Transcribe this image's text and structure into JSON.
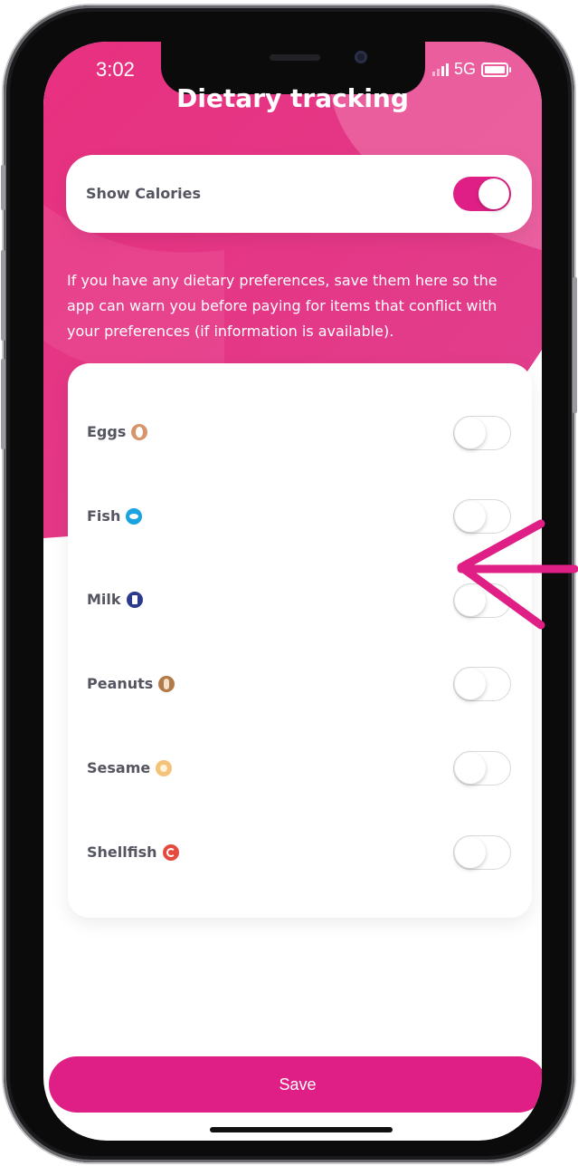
{
  "status_bar": {
    "time": "3:02",
    "network": "5G"
  },
  "page": {
    "title": "Dietary tracking"
  },
  "calories": {
    "label": "Show Calories",
    "enabled": true
  },
  "info_text": "If you have any dietary preferences, save them here so the app can warn you before paying for items that conflict with your preferences (if information is available).",
  "allergens": [
    {
      "label": "Eggs",
      "icon": "egg-icon",
      "color": "#d9956a",
      "enabled": false
    },
    {
      "label": "Fish",
      "icon": "fish-icon",
      "color": "#1aa3e0",
      "enabled": false
    },
    {
      "label": "Milk",
      "icon": "milk-icon",
      "color": "#2b3a8c",
      "enabled": false
    },
    {
      "label": "Peanuts",
      "icon": "peanut-icon",
      "color": "#b27a48",
      "enabled": false
    },
    {
      "label": "Sesame",
      "icon": "sesame-icon",
      "color": "#f5c27a",
      "enabled": false
    },
    {
      "label": "Shellfish",
      "icon": "shellfish-icon",
      "color": "#e44a3d",
      "enabled": false
    }
  ],
  "actions": {
    "save_label": "Save"
  },
  "colors": {
    "accent": "#e01f86",
    "hero_light": "#f06aa8"
  }
}
